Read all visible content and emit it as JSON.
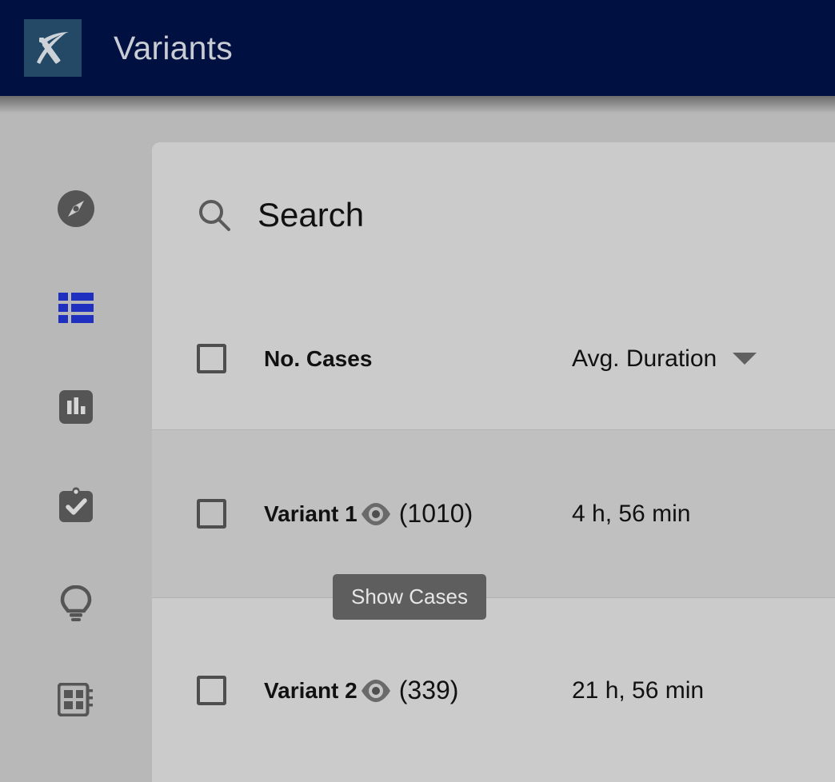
{
  "header": {
    "title": "Variants",
    "logo_icon": "pickaxe-icon",
    "background_color": "#001141",
    "logo_tile_color": "#234967"
  },
  "sidebar": {
    "items": [
      {
        "id": "explore",
        "icon": "compass-icon",
        "active": false
      },
      {
        "id": "variants",
        "icon": "list-table-icon",
        "active": true
      },
      {
        "id": "statistics",
        "icon": "bar-chart-icon",
        "active": false
      },
      {
        "id": "conformance",
        "icon": "clipboard-check-icon",
        "active": false
      },
      {
        "id": "insights",
        "icon": "lightbulb-icon",
        "active": false
      },
      {
        "id": "dashboard",
        "icon": "dashboard-chip-icon",
        "active": false
      }
    ],
    "active_color": "#1f2fbf",
    "inactive_color": "#555555"
  },
  "search": {
    "icon": "search-icon",
    "placeholder": "Search",
    "value": ""
  },
  "table": {
    "columns": {
      "select": "",
      "cases": "No. Cases",
      "duration": "Avg. Duration"
    },
    "sort": {
      "column": "Avg. Duration",
      "direction": "desc",
      "icon": "chevron-down-icon"
    },
    "rows": [
      {
        "name": "Variant 1",
        "eye_icon": "eye-icon",
        "count": "(1010)",
        "duration": "4 h, 56 min",
        "selected": false,
        "hovered": true
      },
      {
        "name": "Variant 2",
        "eye_icon": "eye-icon",
        "count": "(339)",
        "duration": "21 h, 56 min",
        "selected": false,
        "hovered": false
      }
    ]
  },
  "tooltip": {
    "text": "Show Cases",
    "background_color": "#5e5e5e"
  }
}
